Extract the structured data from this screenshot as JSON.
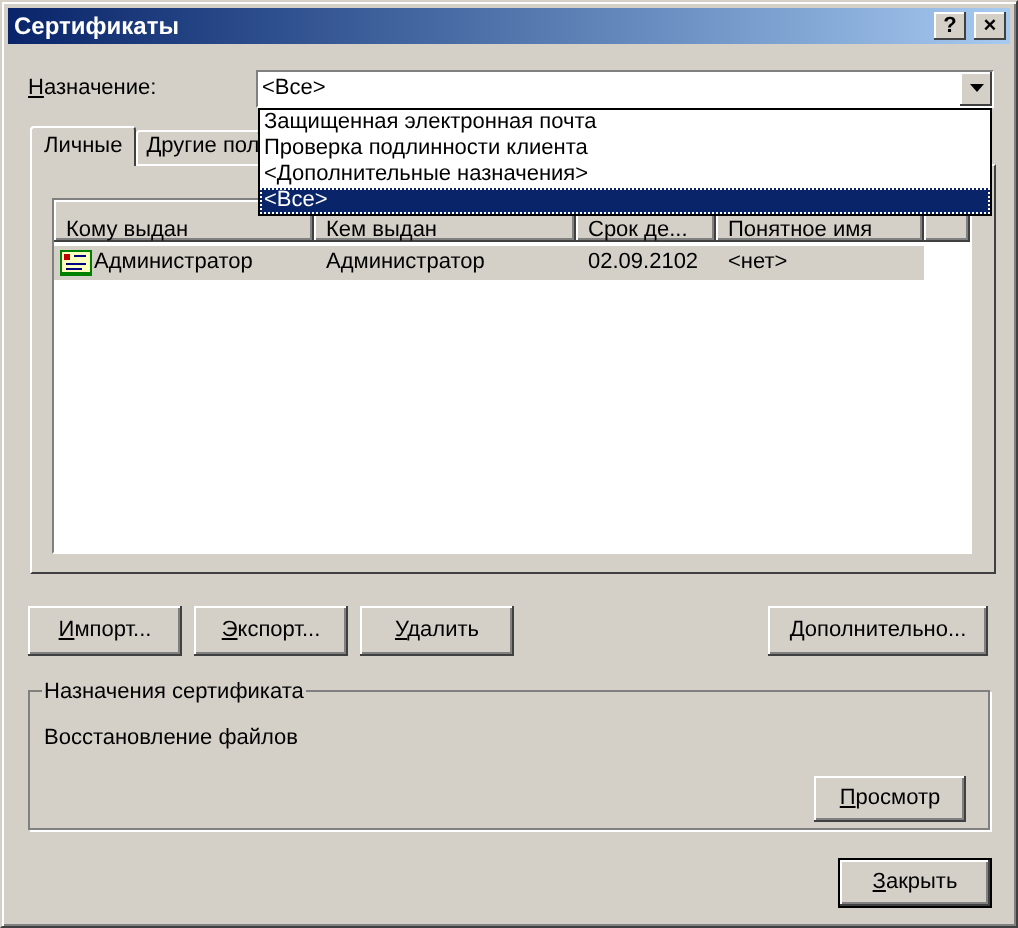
{
  "window": {
    "title": "Сертификаты",
    "buttons": [
      "?",
      "×"
    ]
  },
  "purpose": {
    "label": "Назначение:",
    "value": "<Все>",
    "expanded": true,
    "options": [
      {
        "label": "Защищенная электронная почта",
        "selected": false
      },
      {
        "label": "Проверка подлинности клиента",
        "selected": false
      },
      {
        "label": "<Дополнительные назначения>",
        "selected": false
      },
      {
        "label": "<Все>",
        "selected": true
      }
    ]
  },
  "tabs": [
    {
      "label": "Личные",
      "selected": true
    },
    {
      "label": "Другие пол",
      "selected": false
    }
  ],
  "list": {
    "columns": [
      "Кому выдан",
      "Кем выдан",
      "Срок де...",
      "Понятное имя"
    ],
    "rows": [
      {
        "cells": [
          "Администратор",
          "Администратор",
          "02.09.2102",
          "<нет>"
        ],
        "selected": true
      }
    ]
  },
  "actions": [
    "Импорт...",
    "Экспорт...",
    "Удалить"
  ],
  "advanced_button": "Дополнительно...",
  "purposes_group": {
    "title": "Назначения сертификата",
    "text": "Восстановление файлов",
    "button": "Просмотр"
  },
  "close_button": "Закрыть"
}
